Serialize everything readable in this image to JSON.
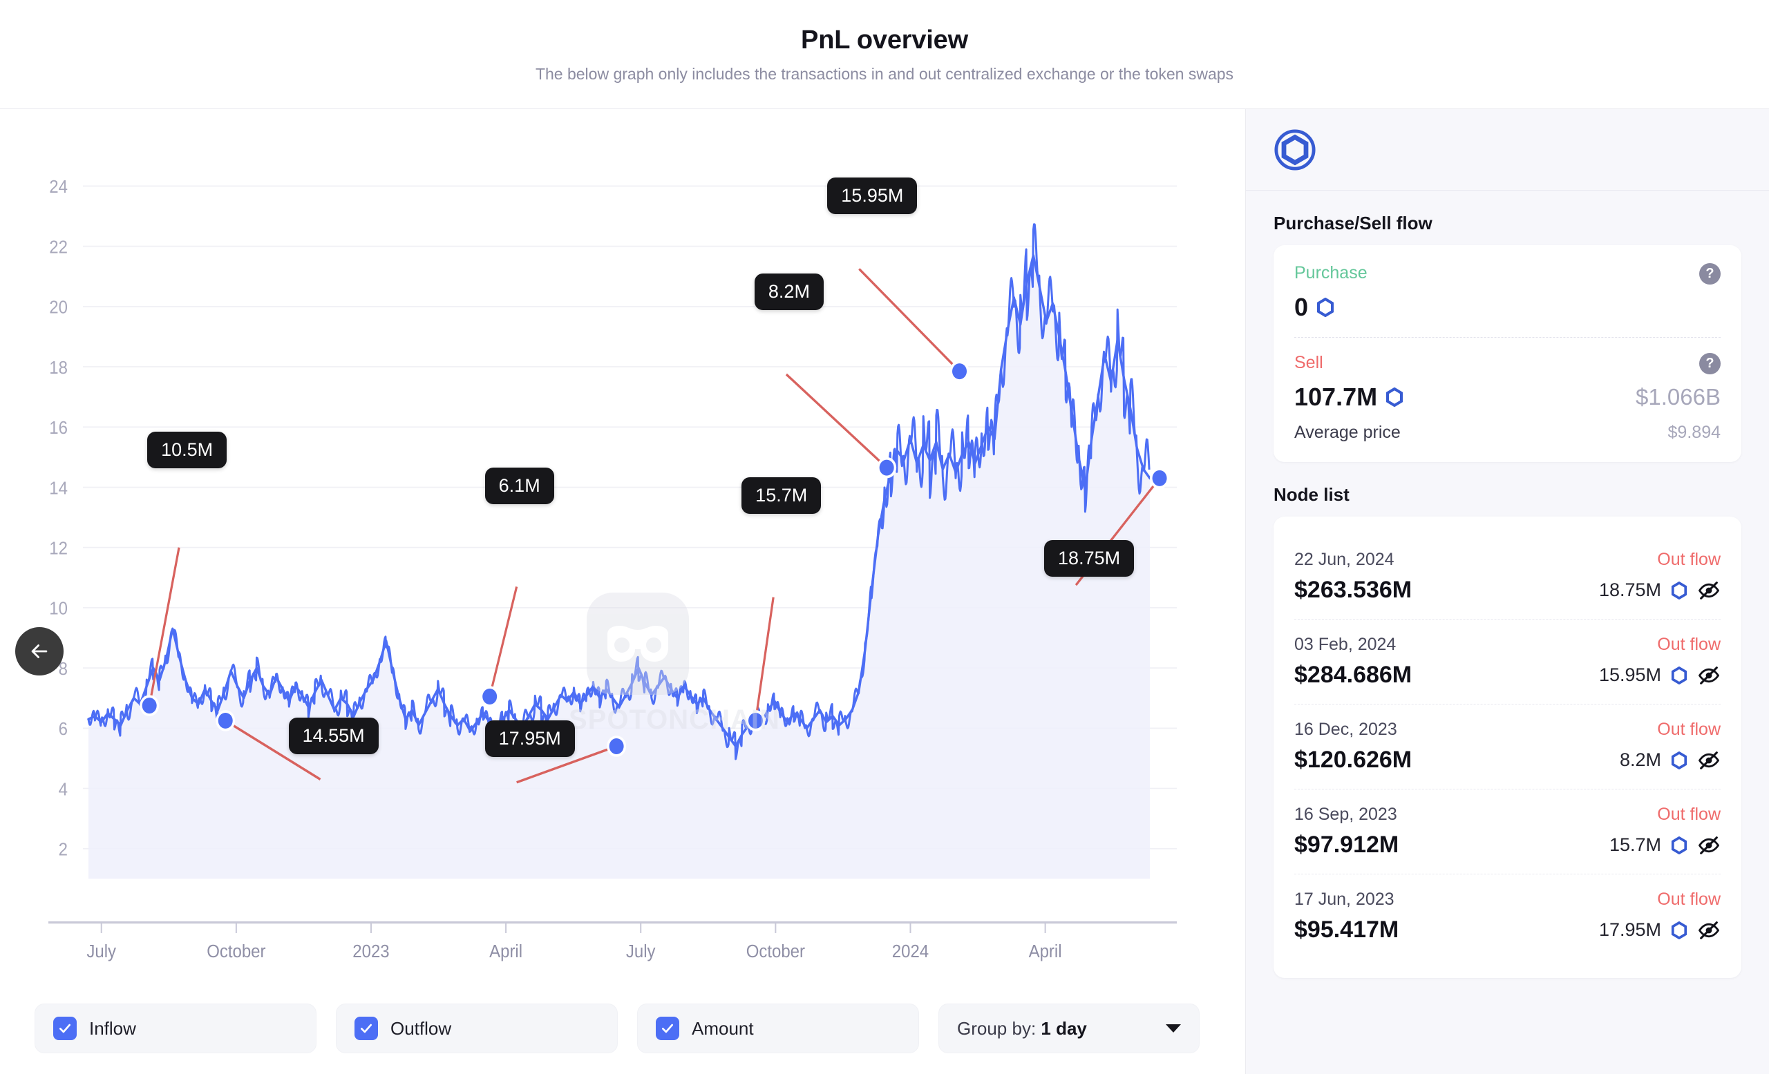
{
  "header": {
    "title": "PnL overview",
    "subtitle": "The below graph only includes the transactions in and out centralized exchange or the token swaps"
  },
  "back_button": {
    "icon": "arrow-left-icon",
    "label": "Back"
  },
  "watermark": {
    "text": "SPOTONCHAIN"
  },
  "controls": {
    "inflow": {
      "label": "Inflow",
      "checked": true
    },
    "outflow": {
      "label": "Outflow",
      "checked": true
    },
    "amount": {
      "label": "Amount",
      "checked": true
    },
    "group_by": {
      "prefix": "Group by: ",
      "value": "1 day"
    }
  },
  "sidebar": {
    "token_icon": "chainlink-token-icon",
    "purchase_sell_flow": {
      "section_title": "Purchase/Sell flow",
      "purchase": {
        "label": "Purchase",
        "amount": "0",
        "usd": "",
        "help_icon": "help-circle-icon"
      },
      "sell": {
        "label": "Sell",
        "amount": "107.7M",
        "usd": "$1.066B",
        "avg_label": "Average price",
        "avg_value": "$9.894",
        "help_icon": "help-circle-icon"
      }
    },
    "node_list": {
      "section_title": "Node list",
      "rows": [
        {
          "date": "22 Jun, 2024",
          "flow": "Out flow",
          "usd": "$263.536M",
          "qty": "18.75M",
          "hidden_icon": "eye-off-icon"
        },
        {
          "date": "03 Feb, 2024",
          "flow": "Out flow",
          "usd": "$284.686M",
          "qty": "15.95M",
          "hidden_icon": "eye-off-icon"
        },
        {
          "date": "16 Dec, 2023",
          "flow": "Out flow",
          "usd": "$120.626M",
          "qty": "8.2M",
          "hidden_icon": "eye-off-icon"
        },
        {
          "date": "16 Sep, 2023",
          "flow": "Out flow",
          "usd": "$97.912M",
          "qty": "15.7M",
          "hidden_icon": "eye-off-icon"
        },
        {
          "date": "17 Jun, 2023",
          "flow": "Out flow",
          "usd": "$95.417M",
          "qty": "17.95M",
          "hidden_icon": "eye-off-icon"
        }
      ]
    }
  },
  "colors": {
    "line": "#4c6ef5",
    "area": "#eef0fb",
    "leader": "#d8625e",
    "annotation_bg": "#17171a",
    "purchase": "#64c79a",
    "sell": "#ef6b6b",
    "accent": "#375bd2"
  },
  "chart_data": {
    "type": "area",
    "title": "PnL overview",
    "xlabel": "",
    "ylabel": "",
    "grid": true,
    "legend": "none",
    "ylim": [
      0,
      25
    ],
    "yticks": [
      2,
      4,
      6,
      8,
      10,
      12,
      14,
      16,
      18,
      20,
      22,
      24
    ],
    "xticks": [
      "July",
      "October",
      "2023",
      "April",
      "July",
      "October",
      "2024",
      "April"
    ],
    "xtick_positions": [
      0.012,
      0.137,
      0.262,
      0.387,
      0.512,
      0.637,
      0.762,
      0.887
    ],
    "series": [
      {
        "name": "Amount",
        "x": [
          0.0,
          0.006,
          0.012,
          0.018,
          0.024,
          0.03,
          0.036,
          0.042,
          0.048,
          0.054,
          0.06,
          0.066,
          0.072,
          0.078,
          0.084,
          0.09,
          0.096,
          0.102,
          0.108,
          0.114,
          0.12,
          0.126,
          0.132,
          0.138,
          0.144,
          0.15,
          0.156,
          0.162,
          0.168,
          0.174,
          0.18,
          0.186,
          0.192,
          0.198,
          0.204,
          0.21,
          0.216,
          0.222,
          0.228,
          0.234,
          0.24,
          0.246,
          0.252,
          0.258,
          0.264,
          0.27,
          0.276,
          0.282,
          0.288,
          0.294,
          0.3,
          0.306,
          0.312,
          0.318,
          0.324,
          0.33,
          0.336,
          0.342,
          0.348,
          0.354,
          0.36,
          0.366,
          0.372,
          0.378,
          0.384,
          0.39,
          0.396,
          0.402,
          0.408,
          0.414,
          0.42,
          0.426,
          0.432,
          0.438,
          0.444,
          0.45,
          0.456,
          0.462,
          0.468,
          0.474,
          0.48,
          0.486,
          0.492,
          0.498,
          0.504,
          0.51,
          0.516,
          0.522,
          0.528,
          0.534,
          0.54,
          0.546,
          0.552,
          0.558,
          0.564,
          0.57,
          0.576,
          0.582,
          0.588,
          0.594,
          0.6,
          0.606,
          0.612,
          0.618,
          0.624,
          0.63,
          0.636,
          0.642,
          0.648,
          0.654,
          0.66,
          0.666,
          0.672,
          0.678,
          0.684,
          0.69,
          0.696,
          0.702,
          0.708,
          0.714,
          0.72,
          0.726,
          0.732,
          0.738,
          0.744,
          0.75,
          0.756,
          0.762,
          0.768,
          0.774,
          0.78,
          0.786,
          0.792,
          0.798,
          0.804,
          0.81,
          0.816,
          0.822,
          0.828,
          0.834,
          0.84,
          0.846,
          0.852,
          0.858,
          0.864,
          0.87,
          0.876,
          0.882,
          0.888,
          0.894,
          0.9,
          0.906,
          0.912,
          0.918,
          0.924,
          0.93,
          0.936,
          0.942,
          0.948,
          0.954,
          0.96,
          0.966,
          0.972,
          0.978,
          0.984,
          0.99,
          0.996
        ],
        "values": [
          6.3,
          6.4,
          6.2,
          6.5,
          6.3,
          6.1,
          6.6,
          7.0,
          6.8,
          7.4,
          8.0,
          7.6,
          8.3,
          9.3,
          8.4,
          7.6,
          7.0,
          6.8,
          7.3,
          6.9,
          6.6,
          7.2,
          7.9,
          7.4,
          7.0,
          7.6,
          8.0,
          7.4,
          7.1,
          7.7,
          7.3,
          6.9,
          7.4,
          7.1,
          6.7,
          7.2,
          7.6,
          7.1,
          6.6,
          7.0,
          6.8,
          6.4,
          6.9,
          7.3,
          7.6,
          8.2,
          8.9,
          7.9,
          7.0,
          6.3,
          6.6,
          6.1,
          6.5,
          6.9,
          7.3,
          6.8,
          6.4,
          6.1,
          6.3,
          5.9,
          6.2,
          6.5,
          6.2,
          5.9,
          6.3,
          6.6,
          6.3,
          6.0,
          6.4,
          6.8,
          6.6,
          6.3,
          6.7,
          7.1,
          6.9,
          7.2,
          6.8,
          7.1,
          7.4,
          7.0,
          7.3,
          7.0,
          6.7,
          7.1,
          7.5,
          8.0,
          7.5,
          7.1,
          7.4,
          7.7,
          7.3,
          7.0,
          7.4,
          7.1,
          6.8,
          7.0,
          6.6,
          6.3,
          6.0,
          5.7,
          5.4,
          5.8,
          6.1,
          6.4,
          6.2,
          6.6,
          6.9,
          6.5,
          6.2,
          6.5,
          6.3,
          6.0,
          6.3,
          6.6,
          6.2,
          6.4,
          6.1,
          6.3,
          6.6,
          7.2,
          8.6,
          10.6,
          12.4,
          13.6,
          14.5,
          15.2,
          14.9,
          15.6,
          14.8,
          15.4,
          14.9,
          15.5,
          14.6,
          15.1,
          14.5,
          15.1,
          15.5,
          14.8,
          15.4,
          16.0,
          15.6,
          17.9,
          19.2,
          20.3,
          19.4,
          20.8,
          21.7,
          20.6,
          19.5,
          20.1,
          19.0,
          17.8,
          16.4,
          15.0,
          13.9,
          15.6,
          17.0,
          18.4,
          17.5,
          18.9,
          17.6,
          16.6,
          15.3,
          14.6,
          14.3
        ],
        "unit": "M"
      }
    ],
    "annotations": [
      {
        "label": "10.5M",
        "point_x": 0.0565,
        "point_y": 6.75,
        "box_x": 0.0545,
        "box_y": 12.35,
        "anchor": "below"
      },
      {
        "label": "14.55M",
        "point_x": 0.127,
        "point_y": 6.25,
        "box_x": 0.1855,
        "box_y": 3.95,
        "anchor": "above"
      },
      {
        "label": "6.1M",
        "point_x": 0.372,
        "point_y": 7.05,
        "box_x": 0.3675,
        "box_y": 11.05,
        "anchor": "below"
      },
      {
        "label": "17.95M",
        "point_x": 0.4895,
        "point_y": 5.4,
        "box_x": 0.3675,
        "box_y": 3.85,
        "anchor": "above"
      },
      {
        "label": "15.7M",
        "point_x": 0.6185,
        "point_y": 6.25,
        "box_x": 0.6055,
        "box_y": 10.7,
        "anchor": "below"
      },
      {
        "label": "8.2M",
        "point_x": 0.74,
        "point_y": 14.65,
        "box_x": 0.6175,
        "box_y": 18.1,
        "anchor": "below"
      },
      {
        "label": "15.95M",
        "point_x": 0.8075,
        "point_y": 17.85,
        "box_x": 0.685,
        "box_y": 21.6,
        "anchor": "below"
      },
      {
        "label": "18.75M",
        "point_x": 0.993,
        "point_y": 14.3,
        "box_x": 0.886,
        "box_y": 10.4,
        "anchor": "above"
      }
    ]
  }
}
